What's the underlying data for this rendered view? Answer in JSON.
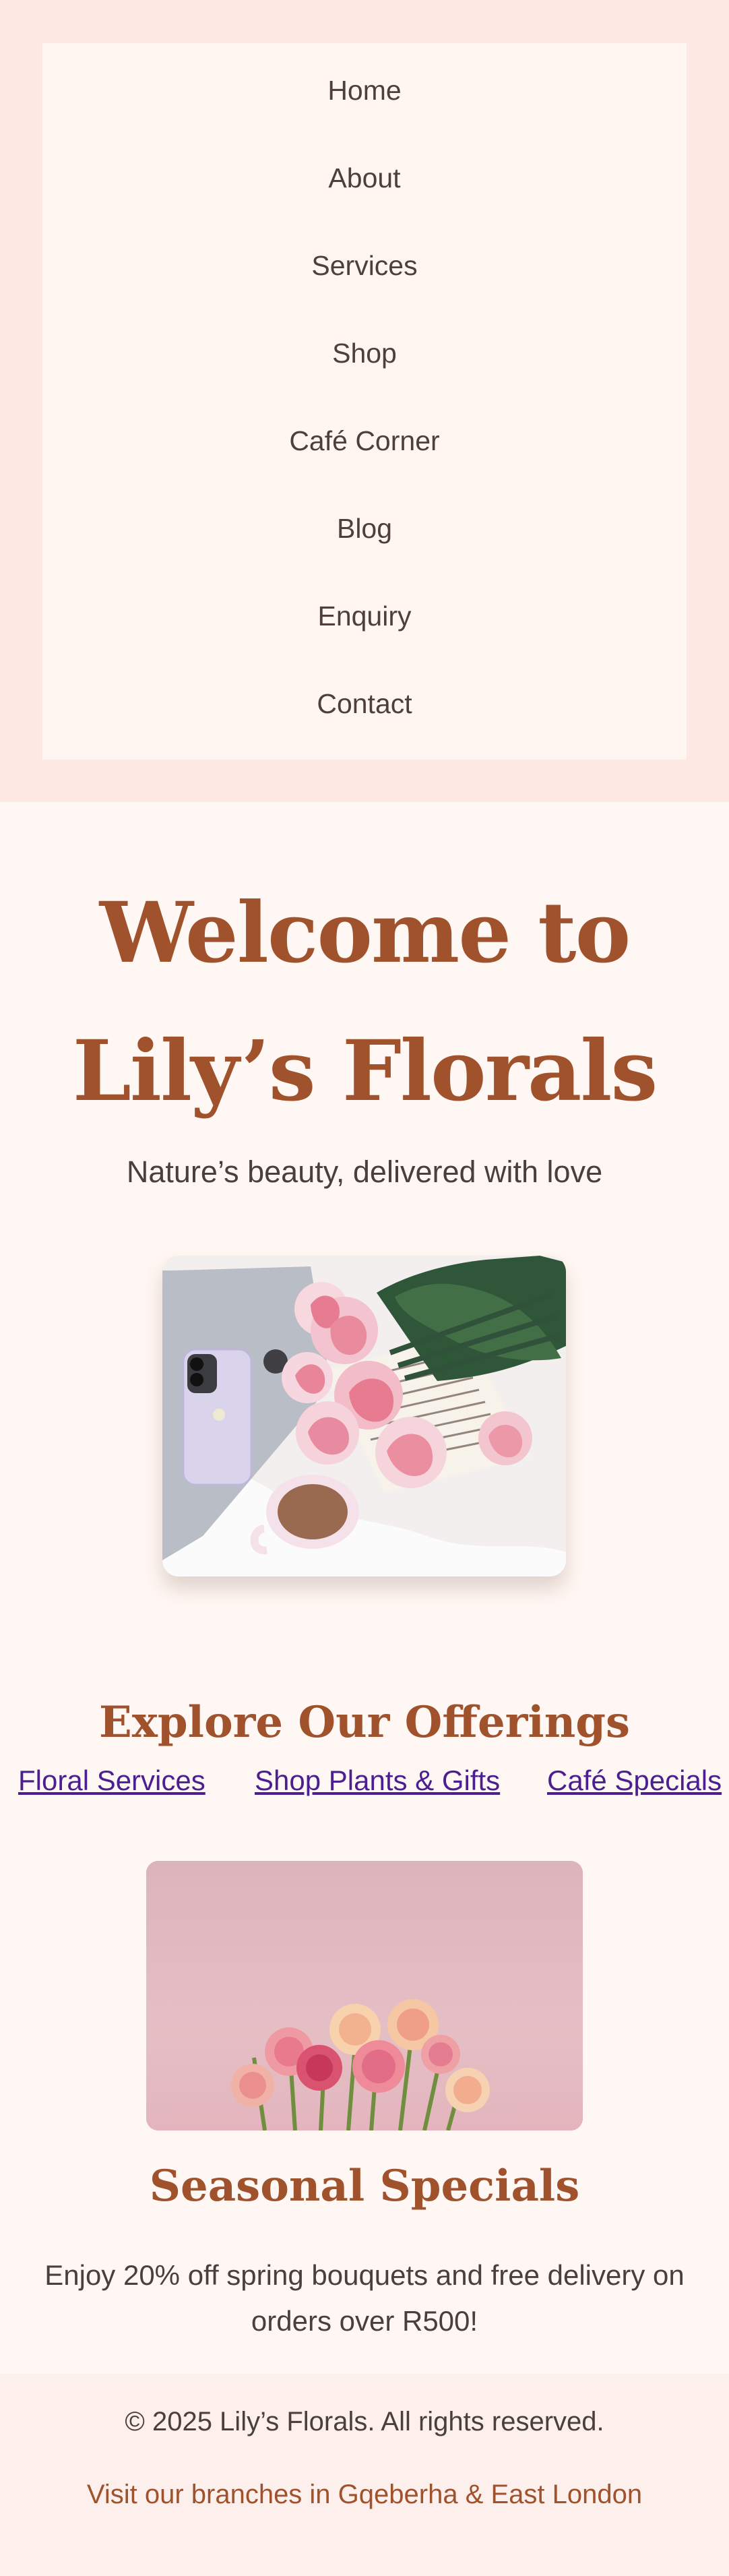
{
  "navigation": {
    "items": [
      {
        "label": "Home"
      },
      {
        "label": "About"
      },
      {
        "label": "Services"
      },
      {
        "label": "Shop"
      },
      {
        "label": "Café Corner"
      },
      {
        "label": "Blog"
      },
      {
        "label": "Enquiry"
      },
      {
        "label": "Contact"
      }
    ]
  },
  "hero": {
    "title": "Welcome to Lily’s Florals",
    "subtitle": "Nature’s beauty, delivered with love"
  },
  "offerings": {
    "title": "Explore Our Offerings",
    "links": [
      {
        "label": "Floral Services"
      },
      {
        "label": "Shop Plants & Gifts"
      },
      {
        "label": "Café Specials"
      }
    ]
  },
  "seasonal": {
    "title": "Seasonal Specials",
    "text": "Enjoy 20% off spring bouquets and free delivery on orders over R500!"
  },
  "footer": {
    "copyright": "© 2025 Lily’s Florals. All rights reserved.",
    "branches": "Visit our branches in Gqeberha & East London"
  },
  "colors": {
    "accent": "#a0522d",
    "background": "#fff7f3",
    "nav_background": "#fde8e4",
    "nav_panel": "#fff6f1",
    "link": "#4b1f8f"
  }
}
